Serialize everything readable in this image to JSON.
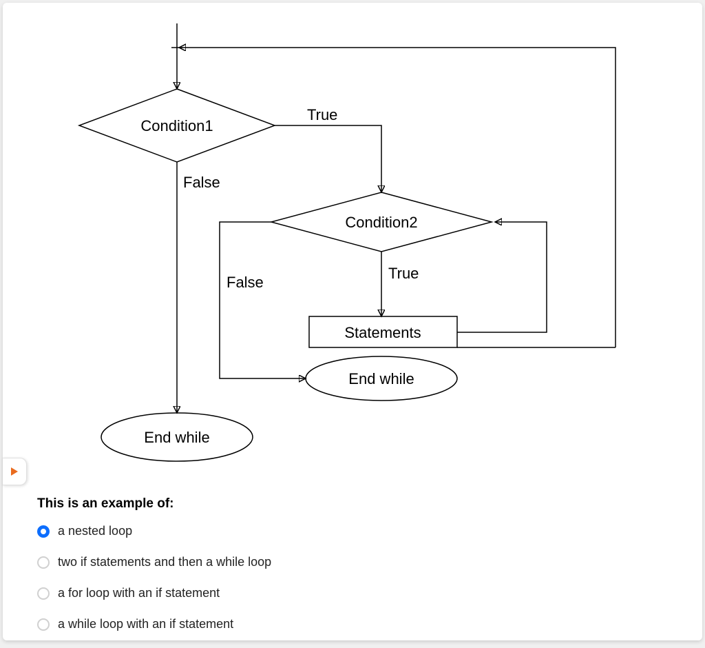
{
  "flowchart": {
    "condition1": "Condition1",
    "condition2": "Condition2",
    "true_label": "True",
    "false_label": "False",
    "true_label2": "True",
    "false_label2": "False",
    "statements": "Statements",
    "end_while_inner": "End while",
    "end_while_outer": "End while"
  },
  "question": {
    "prompt": "This is an example of:",
    "selected_index": 0,
    "options": [
      "a nested loop",
      "two if statements and then a while loop",
      "a for loop with an if statement",
      "a while loop with an if statement"
    ]
  }
}
